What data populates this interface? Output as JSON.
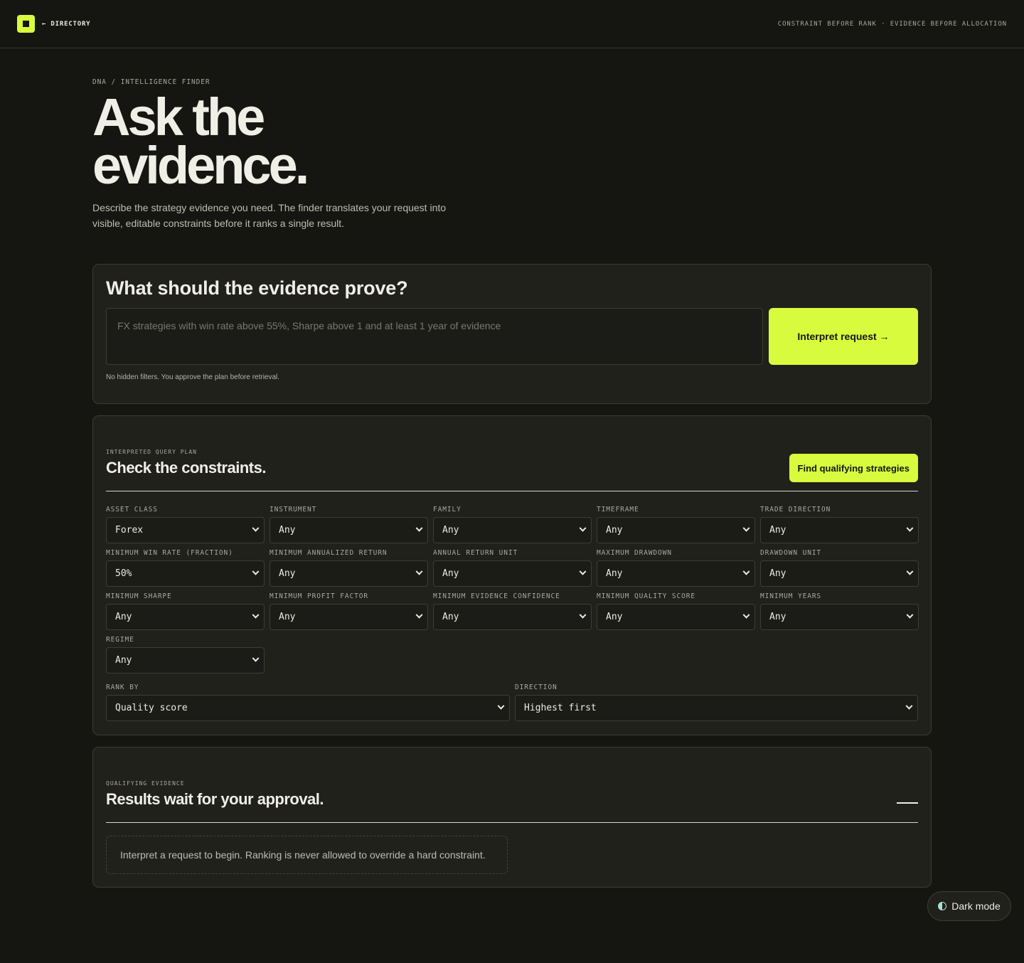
{
  "topbar": {
    "back_label": "← DIRECTORY",
    "tagline": "CONSTRAINT BEFORE RANK · EVIDENCE BEFORE ALLOCATION"
  },
  "hero": {
    "breadcrumb": "DNA / INTELLIGENCE FINDER",
    "title_line1": "Ask the",
    "title_line2": "evidence.",
    "lede": "Describe the strategy evidence you need. The finder translates your request into visible, editable constraints before it ranks a single result."
  },
  "prompt": {
    "title": "What should the evidence prove?",
    "placeholder": "FX strategies with win rate above 55%, Sharpe above 1 and at least 1 year of evidence",
    "button": "Interpret request →",
    "hint": "No hidden filters. You approve the plan before retrieval."
  },
  "plan": {
    "eyebrow": "INTERPRETED QUERY PLAN",
    "title": "Check the constraints.",
    "button": "Find qualifying strategies",
    "fields": [
      {
        "label": "ASSET CLASS",
        "value": "Forex"
      },
      {
        "label": "INSTRUMENT",
        "value": "Any"
      },
      {
        "label": "FAMILY",
        "value": "Any"
      },
      {
        "label": "TIMEFRAME",
        "value": "Any"
      },
      {
        "label": "TRADE DIRECTION",
        "value": "Any"
      },
      {
        "label": "MINIMUM WIN RATE (FRACTION)",
        "value": "50%"
      },
      {
        "label": "MINIMUM ANNUALIZED RETURN",
        "value": "Any"
      },
      {
        "label": "ANNUAL RETURN UNIT",
        "value": "Any"
      },
      {
        "label": "MAXIMUM DRAWDOWN",
        "value": "Any"
      },
      {
        "label": "DRAWDOWN UNIT",
        "value": "Any"
      },
      {
        "label": "MINIMUM SHARPE",
        "value": "Any"
      },
      {
        "label": "MINIMUM PROFIT FACTOR",
        "value": "Any"
      },
      {
        "label": "MINIMUM EVIDENCE CONFIDENCE",
        "value": "Any"
      },
      {
        "label": "MINIMUM QUALITY SCORE",
        "value": "Any"
      },
      {
        "label": "MINIMUM YEARS",
        "value": "Any"
      },
      {
        "label": "REGIME",
        "value": "Any"
      }
    ],
    "rank_by": {
      "label": "RANK BY",
      "value": "Quality score"
    },
    "direction": {
      "label": "DIRECTION",
      "value": "Highest first"
    }
  },
  "results": {
    "eyebrow": "QUALIFYING EVIDENCE",
    "title": "Results wait for your approval.",
    "empty": "Interpret a request to begin. Ranking is never allowed to override a hard constraint."
  },
  "theme": {
    "label": "Dark mode"
  },
  "colors": {
    "accent": "#d9fb3d",
    "background": "#151611",
    "card": "#20211b"
  }
}
